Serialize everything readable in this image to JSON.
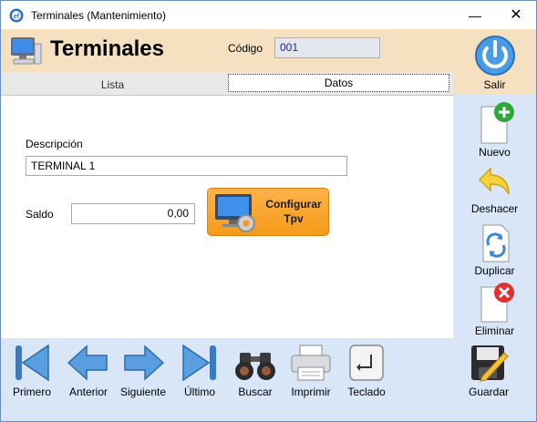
{
  "window": {
    "title": "Terminales (Mantenimiento)"
  },
  "header": {
    "title": "Terminales",
    "codigo_label": "Código",
    "codigo_value": "001"
  },
  "tabs": [
    {
      "label": "Lista",
      "active": false
    },
    {
      "label": "Datos",
      "active": true
    }
  ],
  "form": {
    "descripcion_label": "Descripción",
    "descripcion_value": "TERMINAL 1",
    "saldo_label": "Saldo",
    "saldo_value": "0,00",
    "tpv_button_line1": "Configurar",
    "tpv_button_line2": "Tpv"
  },
  "right_toolbar": {
    "salir": "Salir",
    "nuevo": "Nuevo",
    "deshacer": "Deshacer",
    "duplicar": "Duplicar",
    "eliminar": "Eliminar",
    "guardar": "Guardar"
  },
  "bottom_toolbar": {
    "primero": "Primero",
    "anterior": "Anterior",
    "siguiente": "Siguiente",
    "ultimo": "Último",
    "buscar": "Buscar",
    "imprimir": "Imprimir",
    "teclado": "Teclado"
  },
  "colors": {
    "header_bg": "#f5e0c0",
    "toolbar_bg": "#d8e6f7",
    "accent_orange": "#f59a1a",
    "nav_blue": "#3a7cc4"
  }
}
